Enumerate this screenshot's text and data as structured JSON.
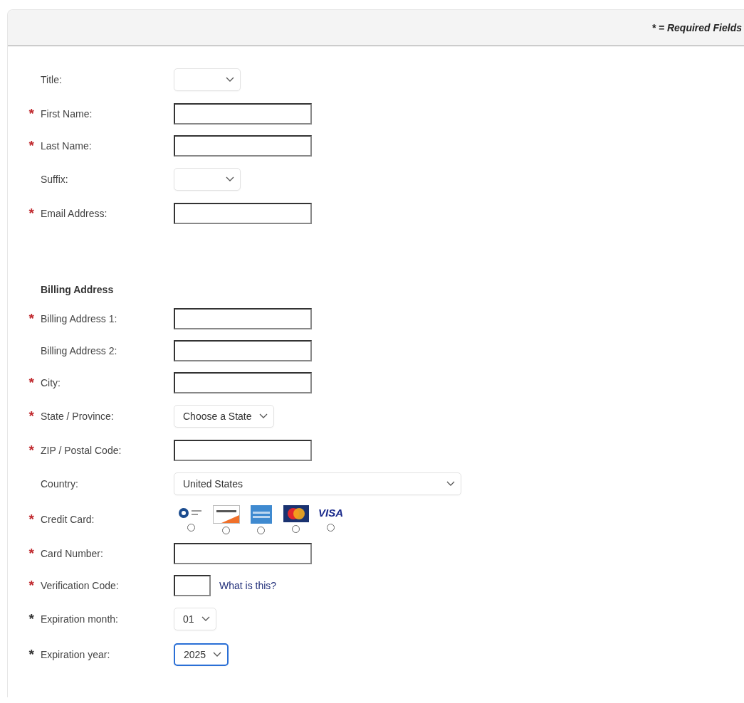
{
  "header": {
    "note": "* = Required Fields"
  },
  "required_mark": "*",
  "personal": [
    {
      "label": "Title:",
      "required": false,
      "kind": "select",
      "focused": false
    },
    {
      "label": "First Name:",
      "required": true,
      "color": "#c0282d",
      "kind": "text"
    },
    {
      "label": "Last Name:",
      "required": true,
      "color": "#c0282d",
      "kind": "text"
    },
    {
      "label": "Suffix:",
      "required": false,
      "kind": "select",
      "focused": false
    },
    {
      "label": "Email Address:",
      "required": true,
      "color": "#c0282d",
      "kind": "text"
    }
  ],
  "billing": {
    "heading": "Billing Address",
    "rows": [
      {
        "label": "Billing Address 1:",
        "required": true,
        "color": "#c0282d",
        "kind": "text"
      },
      {
        "label": "Billing Address 2:",
        "required": false,
        "kind": "text"
      },
      {
        "label": "City:",
        "required": true,
        "color": "#c0282d",
        "kind": "text"
      },
      {
        "label": "State / Province:",
        "required": true,
        "color": "#c0282d",
        "kind": "select",
        "value": "Choose a State",
        "focused": false
      },
      {
        "label": "ZIP / Postal Code:",
        "required": true,
        "color": "#c0282d",
        "kind": "text"
      },
      {
        "label": "Country:",
        "required": false,
        "kind": "wide-select",
        "value": "United States",
        "focused": false
      },
      {
        "label": "Credit Card:",
        "required": true,
        "color": "#c0282d",
        "kind": "cards",
        "cards": [
          {
            "kind": "diners",
            "selected": false
          },
          {
            "kind": "discover",
            "selected": false
          },
          {
            "kind": "amex",
            "selected": false
          },
          {
            "kind": "mastercard",
            "selected": false
          },
          {
            "kind": "visa",
            "label": "VISA",
            "selected": false
          }
        ]
      },
      {
        "label": "Card Number:",
        "required": true,
        "color": "#c0282d",
        "kind": "text"
      },
      {
        "label": "Verification Code:",
        "required": true,
        "color": "#c0282d",
        "kind": "short-text",
        "link": "What is this?"
      },
      {
        "label": "Expiration month:",
        "required": true,
        "color": "#333333",
        "kind": "select",
        "value": "01",
        "focused": false
      },
      {
        "label": "Expiration year:",
        "required": true,
        "color": "#333333",
        "kind": "select",
        "value": "2025",
        "focused": true
      }
    ]
  }
}
